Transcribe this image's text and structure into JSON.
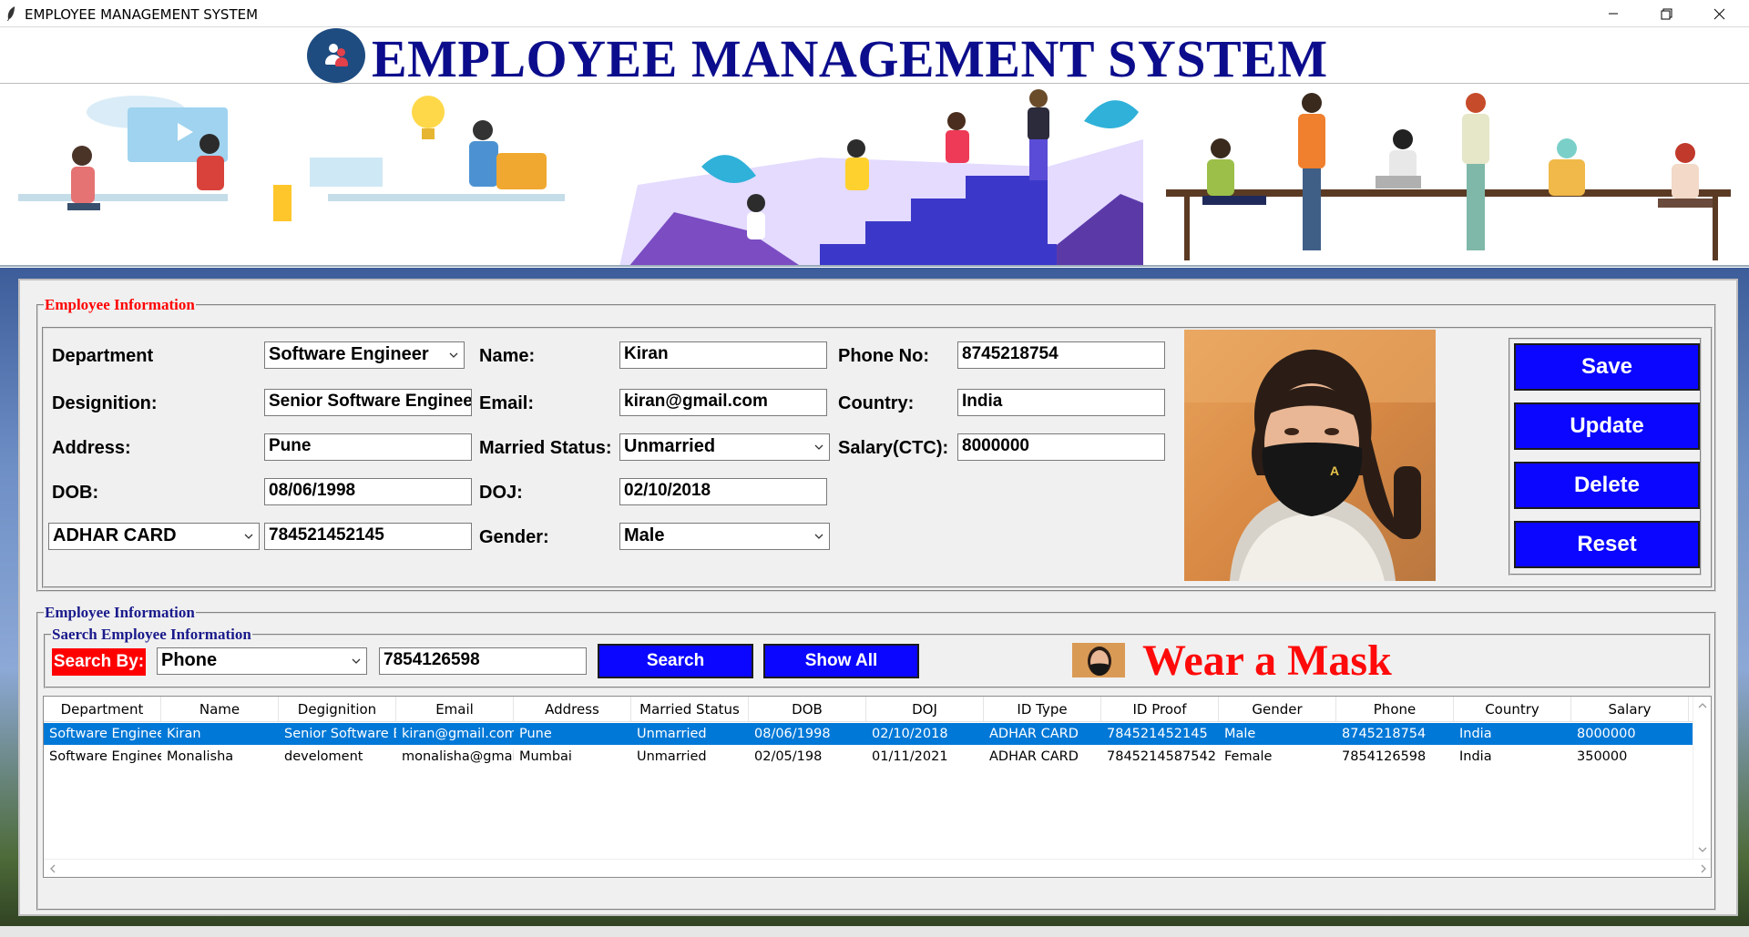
{
  "window": {
    "title": "EMPLOYEE MANAGEMENT SYSTEM",
    "minimize_icon": "minimize-icon",
    "restore_icon": "restore-icon",
    "close_icon": "close-icon"
  },
  "header": {
    "title": "EMPLOYEE MANAGEMENT SYSTEM",
    "logo_icon": "people-icon"
  },
  "colors": {
    "title_blue": "#0c0d8c",
    "button_blue": "#0a06ff",
    "legend_red": "#ff0000",
    "legend_navy": "#1a1a8c",
    "selection": "#0078d7",
    "mask_text_red": "#ff0a0a"
  },
  "form": {
    "legend": "Employee Information",
    "department_label": "Department",
    "department_value": "Software Engineer",
    "designation_label": "Designition:",
    "designation_value": "Senior Software Engineer",
    "address_label": "Address:",
    "address_value": "Pune",
    "dob_label": "DOB:",
    "dob_value": "08/06/1998",
    "id_type_value": "ADHAR CARD",
    "id_number_value": "784521452145",
    "name_label": "Name:",
    "name_value": "Kiran",
    "email_label": "Email:",
    "email_value": "kiran@gmail.com",
    "married_label": "Married Status:",
    "married_value": "Unmarried",
    "doj_label": "DOJ:",
    "doj_value": "02/10/2018",
    "gender_label": "Gender:",
    "gender_value": "Male",
    "phone_label": "Phone No:",
    "phone_value": "8745218754",
    "country_label": "Country:",
    "country_value": "India",
    "salary_label": "Salary(CTC):",
    "salary_value": "8000000"
  },
  "buttons": {
    "save": "Save",
    "update": "Update",
    "delete": "Delete",
    "reset": "Reset"
  },
  "search": {
    "outer_legend": "Employee Information",
    "legend": "Saerch Employee Information",
    "label": "Search By:",
    "field_value": "Phone",
    "query_value": "7854126598",
    "search_button": "Search",
    "show_all_button": "Show All",
    "banner_text": "Wear a Mask"
  },
  "table": {
    "columns": [
      "Department",
      "Name",
      "Degignition",
      "Email",
      "Address",
      "Married Status",
      "DOB",
      "DOJ",
      "ID Type",
      "ID Proof",
      "Gender",
      "Phone",
      "Country",
      "Salary"
    ],
    "rows": [
      [
        "Software Engineer",
        "Kiran",
        "Senior Software Er",
        "kiran@gmail.com",
        "Pune",
        "Unmarried",
        "08/06/1998",
        "02/10/2018",
        "ADHAR CARD",
        "784521452145",
        "Male",
        "8745218754",
        "India",
        "8000000"
      ],
      [
        "Software Engineer",
        "Monalisha",
        "develoment",
        "monalisha@gmail",
        "Mumbai",
        "Unmarried",
        "02/05/198",
        "01/11/2021",
        "ADHAR CARD",
        "7845214587542",
        "Female",
        "7854126598",
        "India",
        "350000"
      ]
    ],
    "selected_row": 0
  }
}
